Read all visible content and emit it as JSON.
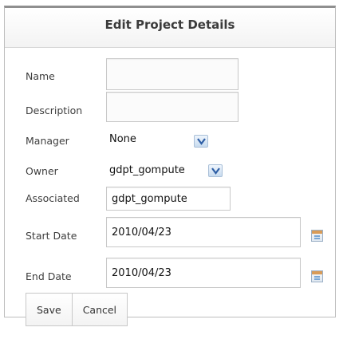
{
  "dialog": {
    "title": "Edit Project Details"
  },
  "fields": {
    "name": {
      "label": "Name",
      "value": ""
    },
    "description": {
      "label": "Description",
      "value": ""
    },
    "manager": {
      "label": "Manager",
      "value": "None"
    },
    "owner": {
      "label": "Owner",
      "value": "gdpt_gompute"
    },
    "associated": {
      "label": "Associated",
      "value": "gdpt_gompute"
    },
    "start_date": {
      "label": "Start Date",
      "value": "2010/04/23"
    },
    "end_date": {
      "label": "End Date",
      "value": "2010/04/23"
    }
  },
  "buttons": {
    "save": "Save",
    "cancel": "Cancel"
  },
  "icons": {
    "dropdown": "chevron-down-icon",
    "calendar": "calendar-icon"
  },
  "colors": {
    "dropdown_arrow": "#2f5fa6",
    "calendar_band": "#d89b57"
  }
}
